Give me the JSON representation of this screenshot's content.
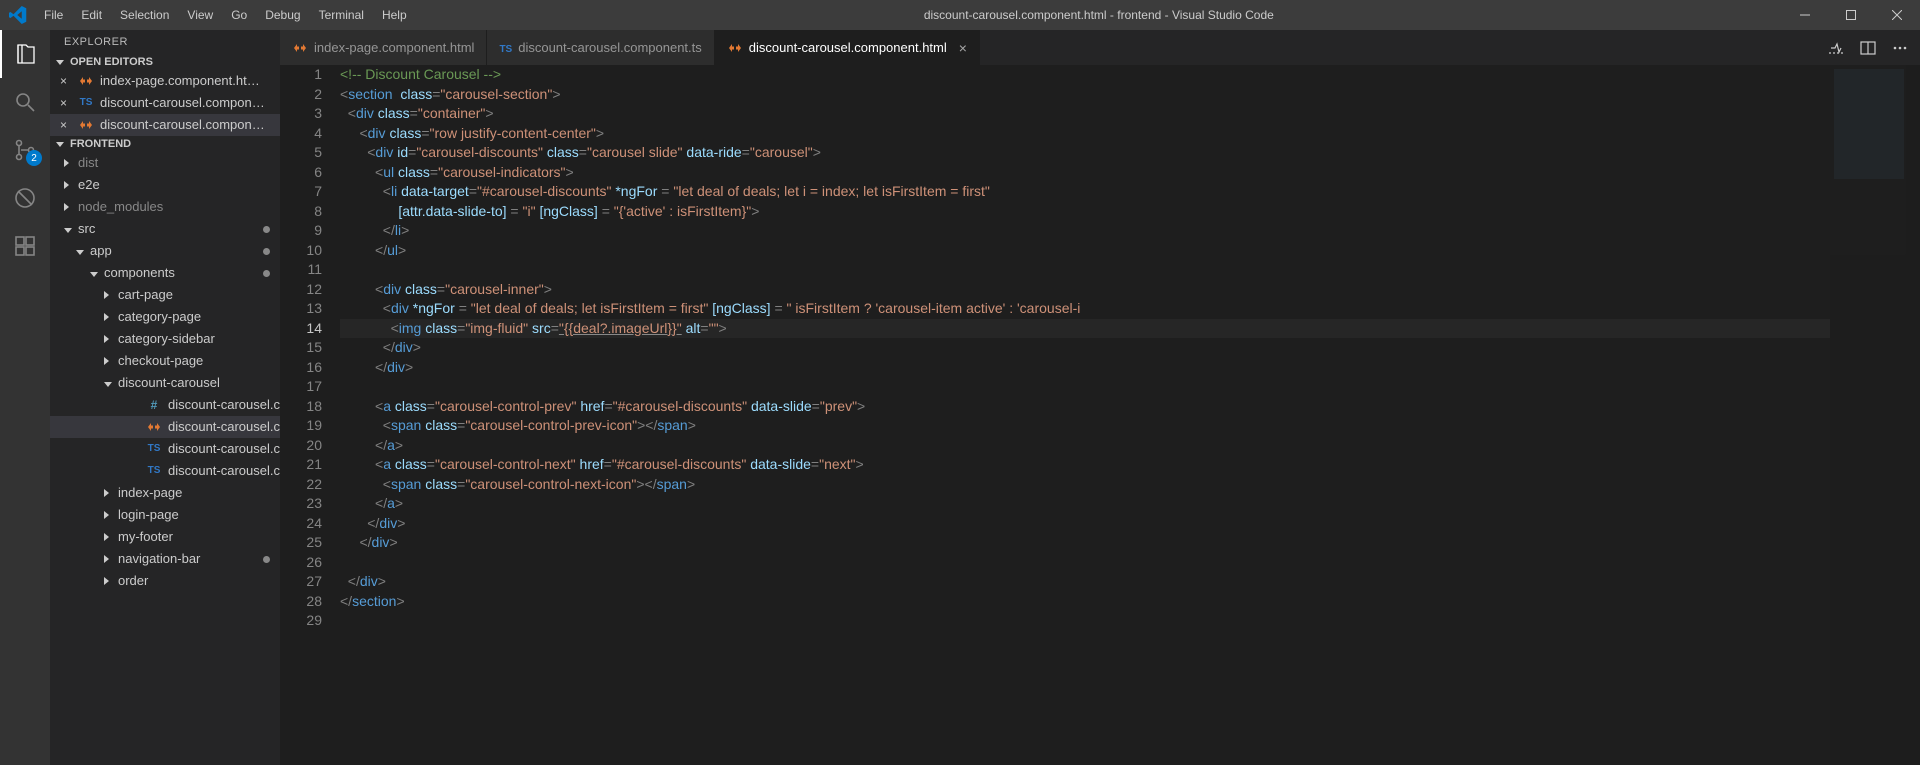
{
  "title": "discount-carousel.component.html - frontend - Visual Studio Code",
  "menu": [
    "File",
    "Edit",
    "Selection",
    "View",
    "Go",
    "Debug",
    "Terminal",
    "Help"
  ],
  "activity": {
    "scm_badge": "2"
  },
  "sidebar": {
    "title": "EXPLORER",
    "open_editors_label": "OPEN EDITORS",
    "open_editors": [
      {
        "label": "index-page.component.ht…",
        "type": "html"
      },
      {
        "label": "discount-carousel.compon…",
        "type": "ts"
      },
      {
        "label": "discount-carousel.compon…",
        "type": "html",
        "active": true
      }
    ],
    "project_label": "FRONTEND",
    "tree": [
      {
        "label": "dist",
        "type": "folder",
        "indent": 0,
        "expand": "right",
        "dim": true
      },
      {
        "label": "e2e",
        "type": "folder",
        "indent": 0,
        "expand": "right"
      },
      {
        "label": "node_modules",
        "type": "folder",
        "indent": 0,
        "expand": "right",
        "dim": true
      },
      {
        "label": "src",
        "type": "folder",
        "indent": 0,
        "expand": "down",
        "dot": true
      },
      {
        "label": "app",
        "type": "folder",
        "indent": 1,
        "expand": "down",
        "dot": true
      },
      {
        "label": "components",
        "type": "folder",
        "indent": 2,
        "expand": "down",
        "dot": true
      },
      {
        "label": "cart-page",
        "type": "folder",
        "indent": 3,
        "expand": "right"
      },
      {
        "label": "category-page",
        "type": "folder",
        "indent": 3,
        "expand": "right"
      },
      {
        "label": "category-sidebar",
        "type": "folder",
        "indent": 3,
        "expand": "right"
      },
      {
        "label": "checkout-page",
        "type": "folder",
        "indent": 3,
        "expand": "right"
      },
      {
        "label": "discount-carousel",
        "type": "folder",
        "indent": 3,
        "expand": "down"
      },
      {
        "label": "discount-carousel.com…",
        "type": "css",
        "indent": 5
      },
      {
        "label": "discount-carousel.com…",
        "type": "html",
        "indent": 5,
        "active": true
      },
      {
        "label": "discount-carousel.com…",
        "type": "ts",
        "indent": 5
      },
      {
        "label": "discount-carousel.com…",
        "type": "ts",
        "indent": 5
      },
      {
        "label": "index-page",
        "type": "folder",
        "indent": 3,
        "expand": "right"
      },
      {
        "label": "login-page",
        "type": "folder",
        "indent": 3,
        "expand": "right"
      },
      {
        "label": "my-footer",
        "type": "folder",
        "indent": 3,
        "expand": "right"
      },
      {
        "label": "navigation-bar",
        "type": "folder",
        "indent": 3,
        "expand": "right",
        "dot": true
      },
      {
        "label": "order",
        "type": "folder",
        "indent": 3,
        "expand": "right"
      }
    ]
  },
  "tabs": [
    {
      "label": "index-page.component.html",
      "type": "html"
    },
    {
      "label": "discount-carousel.component.ts",
      "type": "ts"
    },
    {
      "label": "discount-carousel.component.html",
      "type": "html",
      "active": true,
      "close": true
    }
  ],
  "editor": {
    "current_line": 14,
    "lines": [
      {
        "n": 1,
        "html": "<span class='c-comment'>&lt;!-- Discount Carousel --&gt;</span>"
      },
      {
        "n": 2,
        "html": "<span class='c-pun'>&lt;</span><span class='c-tag'>section</span>  <span class='c-attr'>class</span><span class='c-pun'>=</span><span class='c-str'>\"carousel-section\"</span><span class='c-pun'>&gt;</span>"
      },
      {
        "n": 3,
        "html": "  <span class='c-pun'>&lt;</span><span class='c-tag'>div</span> <span class='c-attr'>class</span><span class='c-pun'>=</span><span class='c-str'>\"container\"</span><span class='c-pun'>&gt;</span>"
      },
      {
        "n": 4,
        "html": "     <span class='c-pun'>&lt;</span><span class='c-tag'>div</span> <span class='c-attr'>class</span><span class='c-pun'>=</span><span class='c-str'>\"row justify-content-center\"</span><span class='c-pun'>&gt;</span>"
      },
      {
        "n": 5,
        "html": "       <span class='c-pun'>&lt;</span><span class='c-tag'>div</span> <span class='c-attr'>id</span><span class='c-pun'>=</span><span class='c-str'>\"carousel-discounts\"</span> <span class='c-attr'>class</span><span class='c-pun'>=</span><span class='c-str'>\"carousel slide\"</span> <span class='c-attr'>data-ride</span><span class='c-pun'>=</span><span class='c-str'>\"carousel\"</span><span class='c-pun'>&gt;</span>"
      },
      {
        "n": 6,
        "html": "         <span class='c-pun'>&lt;</span><span class='c-tag'>ul</span> <span class='c-attr'>class</span><span class='c-pun'>=</span><span class='c-str'>\"carousel-indicators\"</span><span class='c-pun'>&gt;</span>"
      },
      {
        "n": 7,
        "html": "           <span class='c-pun'>&lt;</span><span class='c-tag'>li</span> <span class='c-attr'>data-target</span><span class='c-pun'>=</span><span class='c-str'>\"#carousel-discounts\"</span> <span class='c-attr'>*ngFor</span> <span class='c-pun'>=</span> <span class='c-str'>\"let deal of deals; let i = index; let isFirstItem = first\"</span>"
      },
      {
        "n": 8,
        "html": "               <span class='c-attr'>[attr.data-slide-to]</span> <span class='c-pun'>=</span> <span class='c-str'>\"i\"</span> <span class='c-attr'>[ngClass]</span> <span class='c-pun'>=</span> <span class='c-str'>\"{'active' : isFirstItem}\"</span><span class='c-pun'>&gt;</span>"
      },
      {
        "n": 9,
        "html": "           <span class='c-pun'>&lt;/</span><span class='c-tag'>li</span><span class='c-pun'>&gt;</span>"
      },
      {
        "n": 10,
        "html": "         <span class='c-pun'>&lt;/</span><span class='c-tag'>ul</span><span class='c-pun'>&gt;</span>"
      },
      {
        "n": 11,
        "html": ""
      },
      {
        "n": 12,
        "html": "         <span class='c-pun'>&lt;</span><span class='c-tag'>div</span> <span class='c-attr'>class</span><span class='c-pun'>=</span><span class='c-str'>\"carousel-inner\"</span><span class='c-pun'>&gt;</span>"
      },
      {
        "n": 13,
        "html": "           <span class='c-pun'>&lt;</span><span class='c-tag'>div</span> <span class='c-attr'>*ngFor</span> <span class='c-pun'>=</span> <span class='c-str'>\"let deal of deals; let isFirstItem = first\"</span> <span class='c-attr'>[ngClass]</span> <span class='c-pun'>=</span> <span class='c-str'>\" isFirstItem ? 'carousel-item active' : 'carousel-i</span>"
      },
      {
        "n": 14,
        "html": "             <span class='c-pun'>&lt;</span><span class='c-tag'>img</span> <span class='c-attr'>class</span><span class='c-pun'>=</span><span class='c-str'>\"img-fluid\"</span> <span class='c-attr'>src</span><span class='c-pun'>=</span><span class='c-str underline'>\"{{deal?.imageUrl}}\"</span> <span class='c-attr'>alt</span><span class='c-pun'>=</span><span class='c-str'>\"\"</span><span class='c-pun'>&gt;</span>"
      },
      {
        "n": 15,
        "html": "           <span class='c-pun'>&lt;/</span><span class='c-tag'>div</span><span class='c-pun'>&gt;</span>"
      },
      {
        "n": 16,
        "html": "         <span class='c-pun'>&lt;/</span><span class='c-tag'>div</span><span class='c-pun'>&gt;</span>"
      },
      {
        "n": 17,
        "html": ""
      },
      {
        "n": 18,
        "html": "         <span class='c-pun'>&lt;</span><span class='c-tag'>a</span> <span class='c-attr'>class</span><span class='c-pun'>=</span><span class='c-str'>\"carousel-control-prev\"</span> <span class='c-attr'>href</span><span class='c-pun'>=</span><span class='c-str'>\"#carousel-discounts\"</span> <span class='c-attr'>data-slide</span><span class='c-pun'>=</span><span class='c-str'>\"prev\"</span><span class='c-pun'>&gt;</span>"
      },
      {
        "n": 19,
        "html": "           <span class='c-pun'>&lt;</span><span class='c-tag'>span</span> <span class='c-attr'>class</span><span class='c-pun'>=</span><span class='c-str'>\"carousel-control-prev-icon\"</span><span class='c-pun'>&gt;&lt;/</span><span class='c-tag'>span</span><span class='c-pun'>&gt;</span>"
      },
      {
        "n": 20,
        "html": "         <span class='c-pun'>&lt;/</span><span class='c-tag'>a</span><span class='c-pun'>&gt;</span>"
      },
      {
        "n": 21,
        "html": "         <span class='c-pun'>&lt;</span><span class='c-tag'>a</span> <span class='c-attr'>class</span><span class='c-pun'>=</span><span class='c-str'>\"carousel-control-next\"</span> <span class='c-attr'>href</span><span class='c-pun'>=</span><span class='c-str'>\"#carousel-discounts\"</span> <span class='c-attr'>data-slide</span><span class='c-pun'>=</span><span class='c-str'>\"next\"</span><span class='c-pun'>&gt;</span>"
      },
      {
        "n": 22,
        "html": "           <span class='c-pun'>&lt;</span><span class='c-tag'>span</span> <span class='c-attr'>class</span><span class='c-pun'>=</span><span class='c-str'>\"carousel-control-next-icon\"</span><span class='c-pun'>&gt;&lt;/</span><span class='c-tag'>span</span><span class='c-pun'>&gt;</span>"
      },
      {
        "n": 23,
        "html": "         <span class='c-pun'>&lt;/</span><span class='c-tag'>a</span><span class='c-pun'>&gt;</span>"
      },
      {
        "n": 24,
        "html": "       <span class='c-pun'>&lt;/</span><span class='c-tag'>div</span><span class='c-pun'>&gt;</span>"
      },
      {
        "n": 25,
        "html": "     <span class='c-pun'>&lt;/</span><span class='c-tag'>div</span><span class='c-pun'>&gt;</span>"
      },
      {
        "n": 26,
        "html": ""
      },
      {
        "n": 27,
        "html": "  <span class='c-pun'>&lt;/</span><span class='c-tag'>div</span><span class='c-pun'>&gt;</span>"
      },
      {
        "n": 28,
        "html": "<span class='c-pun'>&lt;/</span><span class='c-tag'>section</span><span class='c-pun'>&gt;</span>"
      },
      {
        "n": 29,
        "html": ""
      }
    ]
  }
}
